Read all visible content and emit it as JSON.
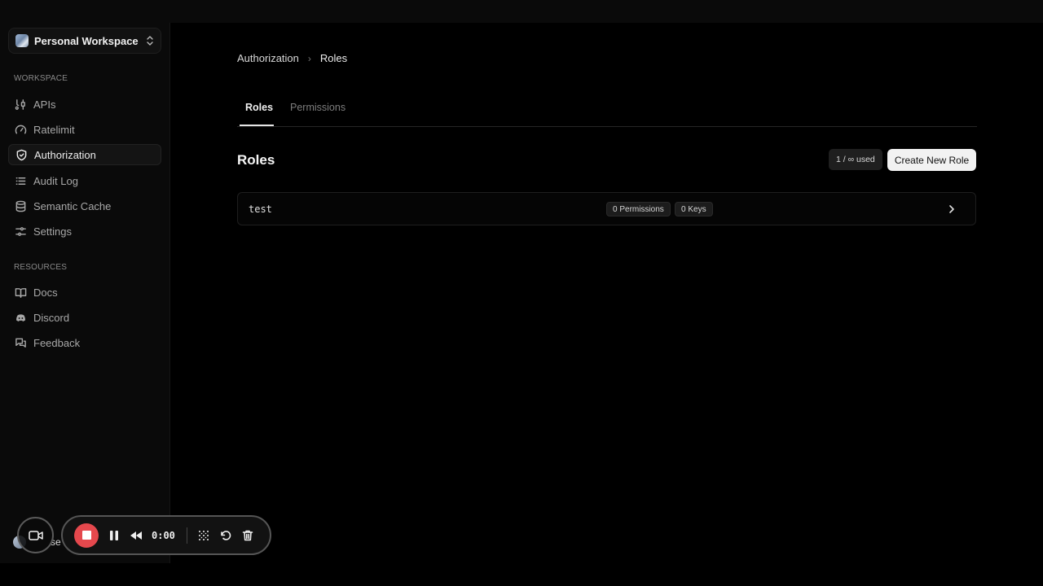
{
  "workspace": {
    "name": "Personal Workspace"
  },
  "sidebar": {
    "workspace_label": "WORKSPACE",
    "workspace_items": [
      {
        "label": "APIs",
        "icon": "api-icon"
      },
      {
        "label": "Ratelimit",
        "icon": "gauge-icon"
      },
      {
        "label": "Authorization",
        "icon": "shield-icon",
        "active": true
      },
      {
        "label": "Audit Log",
        "icon": "list-icon"
      },
      {
        "label": "Semantic Cache",
        "icon": "database-icon"
      },
      {
        "label": "Settings",
        "icon": "sliders-icon"
      }
    ],
    "resources_label": "RESOURCES",
    "resource_items": [
      {
        "label": "Docs",
        "icon": "book-icon"
      },
      {
        "label": "Discord",
        "icon": "discord-icon"
      },
      {
        "label": "Feedback",
        "icon": "chat-icon"
      }
    ],
    "user_name": "se l"
  },
  "breadcrumb": {
    "parent": "Authorization",
    "current": "Roles"
  },
  "tabs": [
    {
      "label": "Roles",
      "active": true
    },
    {
      "label": "Permissions",
      "active": false
    }
  ],
  "main": {
    "title": "Roles",
    "usage": "1 / ∞ used",
    "create_button": "Create New Role"
  },
  "roles": [
    {
      "name": "test",
      "permissions": "0 Permissions",
      "keys": "0 Keys"
    }
  ],
  "recorder": {
    "time": "0:00"
  },
  "colors": {
    "background": "#000000",
    "sidebar": "#0a0a0a",
    "accent": "#f2f2f2",
    "record": "#e5484d"
  }
}
